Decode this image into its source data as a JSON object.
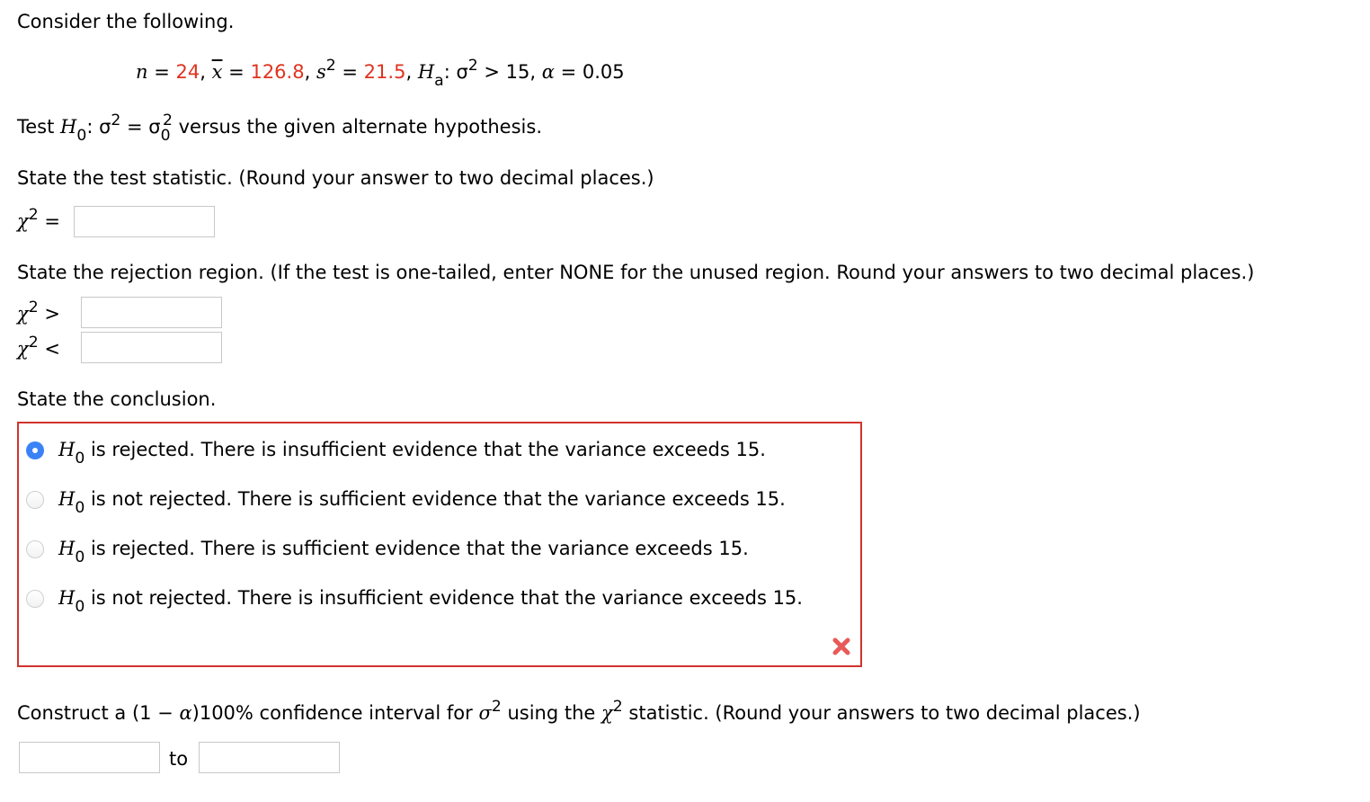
{
  "intro": "Consider the following.",
  "given": {
    "n_label": "n",
    "n_value": "24",
    "xbar_label": "x",
    "xbar_value": "126.8",
    "s2_label": "s",
    "s2_value": "21.5",
    "ha_label": "H",
    "ha_sub": "a",
    "ha_rel": ": σ",
    "ha_rest": "> 15,",
    "alpha_label": "α",
    "alpha_value": "= 0.05",
    "sup2": "2",
    "eq": "=",
    "comma": ","
  },
  "test_hypothesis": {
    "prefix": "Test",
    "h_label": "H",
    "h_sub": "0",
    "colon_sigma": ": σ",
    "sup2": "2",
    "eq_sigma": "= σ",
    "sigma_sub": "0",
    "suffix": "versus the given alternate hypothesis."
  },
  "test_statistic": {
    "prompt": "State the test statistic. (Round your answer to two decimal places.)",
    "label_chi": "χ",
    "label_sup": "2",
    "label_op": "=",
    "value": ""
  },
  "rejection_region": {
    "prompt": "State the rejection region. (If the test is one-tailed, enter NONE for the unused region. Round your answers to two decimal places.)",
    "rows": [
      {
        "chi": "χ",
        "sup": "2",
        "op": ">",
        "value": ""
      },
      {
        "chi": "χ",
        "sup": "2",
        "op": "<",
        "value": ""
      }
    ]
  },
  "conclusion": {
    "prompt": "State the conclusion.",
    "status": "incorrect",
    "status_icon": "x-mark-icon",
    "options": [
      {
        "h": "H",
        "sub": "0",
        "text": "is rejected. There is insufficient evidence that the variance exceeds 15.",
        "selected": true
      },
      {
        "h": "H",
        "sub": "0",
        "text": "is not rejected. There is sufficient evidence that the variance exceeds 15.",
        "selected": false
      },
      {
        "h": "H",
        "sub": "0",
        "text": "is rejected. There is sufficient evidence that the variance exceeds 15.",
        "selected": false
      },
      {
        "h": "H",
        "sub": "0",
        "text": "is not rejected. There is insufficient evidence that the variance exceeds 15.",
        "selected": false
      }
    ]
  },
  "confidence_interval": {
    "prompt_a": "Construct a (1 −",
    "alpha": "α",
    "prompt_b": ")100% confidence interval for",
    "sigma": "σ",
    "sup2": "2",
    "prompt_c": "using the",
    "chi": "χ",
    "prompt_d": "statistic. (Round your answers to two decimal places.)",
    "lower": "",
    "to_label": "to",
    "upper": ""
  },
  "colors": {
    "given_values": "#e0331e",
    "error_border": "#d0342c",
    "radio_selected": "#3b82f6",
    "error_icon": "#e85a5a"
  }
}
